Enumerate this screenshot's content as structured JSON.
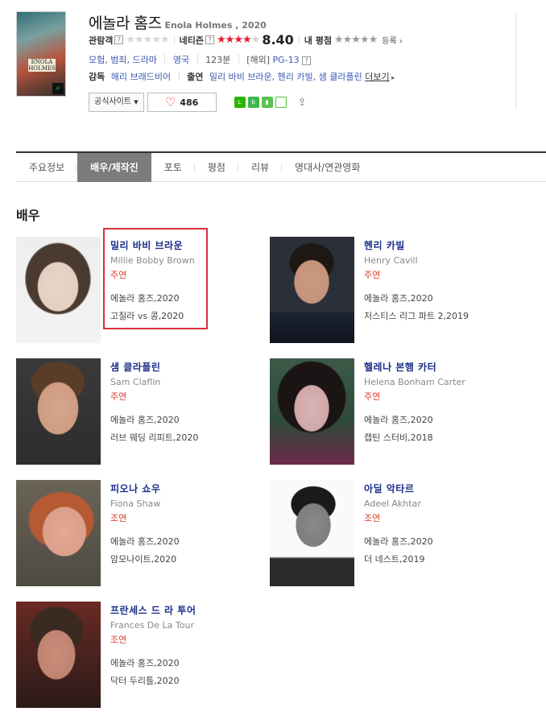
{
  "movie": {
    "title_kr": "에놀라 홈즈",
    "title_en": "Enola Holmes , 2020",
    "poster_text": "ENOLA HOLMES",
    "audience_label": "관람객",
    "netizen_label": "네티즌",
    "netizen_score": "8.40",
    "my_rating_label": "내 평점",
    "register_label": "등록",
    "genres": "모험, 범죄, 드라마",
    "country": "영국",
    "runtime": "123분",
    "rating_prefix": "[해외]",
    "rating": "PG-13",
    "director_label": "감독",
    "director": "해리 브래드비어",
    "cast_label": "출연",
    "cast": "밀리 바비 브라운, 헨리 카빌, 샘 클라플린",
    "more_label": "더보기",
    "official_site_label": "공식사이트",
    "like_count": "486",
    "colors": {
      "accent": "#e8182c",
      "link": "#3a58b0",
      "name": "#1a2f8a"
    }
  },
  "tabs": [
    {
      "label": "주요정보"
    },
    {
      "label": "배우/제작진"
    },
    {
      "label": "포토"
    },
    {
      "label": "평점"
    },
    {
      "label": "리뷰"
    },
    {
      "label": "명대사/연관영화"
    }
  ],
  "section_title": "배우",
  "actors": [
    {
      "name_kr": "밀리 바비 브라운",
      "name_en": "Millie Bobby Brown",
      "role": "주연",
      "film1": "에놀라 홈즈,2020",
      "film2": "고질라 vs 콩,2020"
    },
    {
      "name_kr": "헨리 카빌",
      "name_en": "Henry Cavill",
      "role": "주연",
      "film1": "에놀라 홈즈,2020",
      "film2": "저스티스 리그 파트 2,2019"
    },
    {
      "name_kr": "샘 클라플린",
      "name_en": "Sam Claflin",
      "role": "주연",
      "film1": "에놀라 홈즈,2020",
      "film2": "러브 웨딩 리피트,2020"
    },
    {
      "name_kr": "헬레나 본햄 카터",
      "name_en": "Helena Bonham Carter",
      "role": "주연",
      "film1": "에놀라 홈즈,2020",
      "film2": "캡틴 스터비,2018"
    },
    {
      "name_kr": "피오나 쇼우",
      "name_en": "Fiona Shaw",
      "role": "조연",
      "film1": "에놀라 홈즈,2020",
      "film2": "암모나이트,2020"
    },
    {
      "name_kr": "아딜 악타르",
      "name_en": "Adeel Akhtar",
      "role": "조연",
      "film1": "에놀라 홈즈,2020",
      "film2": "더 네스트,2019"
    },
    {
      "name_kr": "프란세스 드 라 투어",
      "name_en": "Frances De La Tour",
      "role": "조연",
      "film1": "에놀라 홈즈,2020",
      "film2": "닥터 두리틀,2020"
    }
  ]
}
